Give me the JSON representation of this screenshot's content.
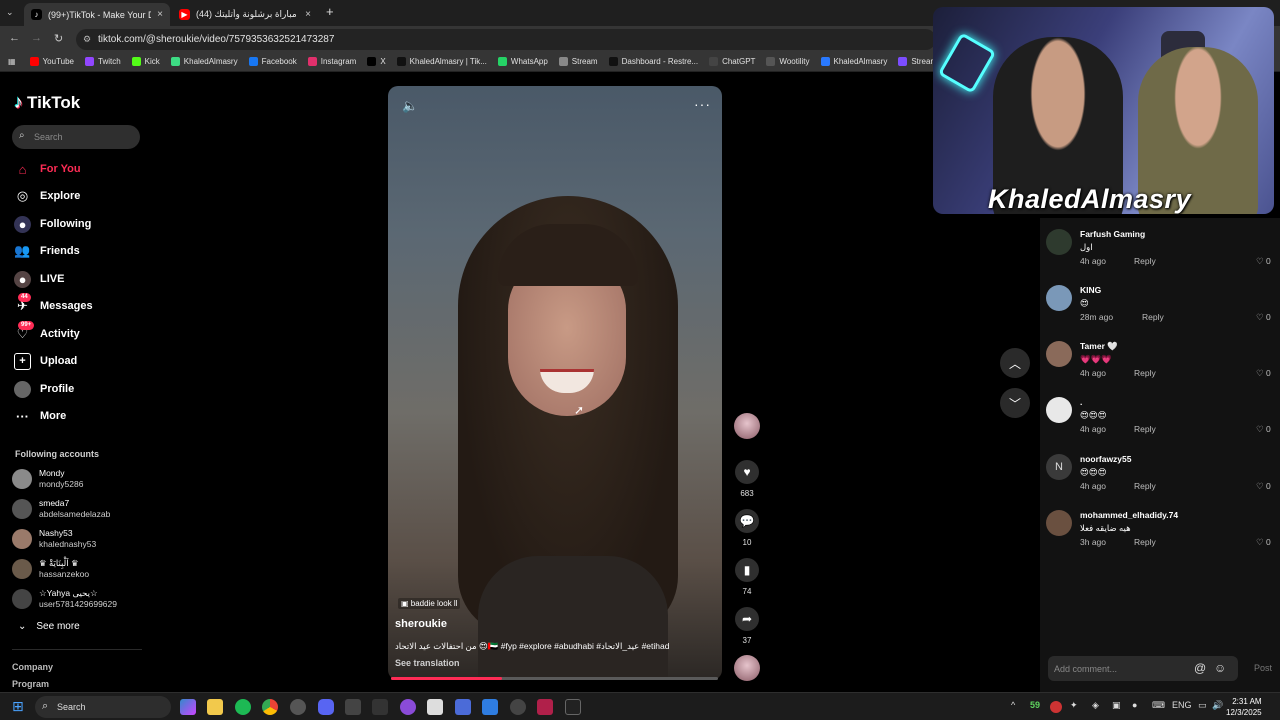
{
  "browser": {
    "tabs": [
      {
        "label": "(99+)TikTok - Make Your Day",
        "close": "×",
        "icon": "tiktok-icon",
        "active": true
      },
      {
        "label": "(44) ملخص مباراة برشلونة وأتليتك",
        "close": "×",
        "icon": "youtube-icon",
        "active": false
      }
    ],
    "new_tab": "+",
    "url": "tiktok.com/@sheroukie/video/7579353632521473287",
    "bookmarks": [
      {
        "label": "YouTube",
        "color": "#ff0000"
      },
      {
        "label": "Twitch",
        "color": "#9146ff"
      },
      {
        "label": "Kick",
        "color": "#53fc18"
      },
      {
        "label": "KhaledAlmasry",
        "color": "#3ddc84"
      },
      {
        "label": "Facebook",
        "color": "#1877f2"
      },
      {
        "label": "Instagram",
        "color": "#e1306c"
      },
      {
        "label": "X",
        "color": "#000000"
      },
      {
        "label": "KhaledAlmasry | Tik...",
        "color": "#111111"
      },
      {
        "label": "WhatsApp",
        "color": "#25d366"
      },
      {
        "label": "Stream",
        "color": "#888888"
      },
      {
        "label": "Dashboard - Restre...",
        "color": "#111111"
      },
      {
        "label": "ChatGPT",
        "color": "#444444"
      },
      {
        "label": "Wootility",
        "color": "#555555"
      },
      {
        "label": "KhaledAlmasry",
        "color": "#2979ff"
      },
      {
        "label": "StreamCharts",
        "color": "#7c4dff"
      }
    ]
  },
  "tiktok": {
    "logo": "TikTok",
    "search_placeholder": "Search",
    "nav": [
      {
        "label": "For You",
        "icon": "home-icon"
      },
      {
        "label": "Explore",
        "icon": "compass-icon"
      },
      {
        "label": "Following",
        "icon": "following-icon"
      },
      {
        "label": "Friends",
        "icon": "friends-icon"
      },
      {
        "label": "LIVE",
        "icon": "live-icon"
      },
      {
        "label": "Messages",
        "icon": "messages-icon",
        "badge": "44"
      },
      {
        "label": "Activity",
        "icon": "activity-icon",
        "badge": "99+"
      },
      {
        "label": "Upload",
        "icon": "upload-icon"
      },
      {
        "label": "Profile",
        "icon": "profile-icon"
      },
      {
        "label": "More",
        "icon": "more-icon"
      }
    ],
    "following_title": "Following accounts",
    "accounts": [
      {
        "name": "Mondy",
        "user": "mondy5286"
      },
      {
        "name": "smeda7",
        "user": "abdelsamedelazab"
      },
      {
        "name": "Nashy53",
        "user": "khalednashy53"
      },
      {
        "name": "♛ اَلْبِنَايَةْ ♛",
        "user": "hassanzekoo"
      },
      {
        "name": "☆Yahya يحيى☆",
        "user": "user5781429699629"
      }
    ],
    "see_more": "See more",
    "footer": [
      "Company",
      "Program"
    ],
    "accent": "#fe2c55"
  },
  "video": {
    "tag": "baddie look ll",
    "username": "sheroukie",
    "description": "من احتفالات عيد الاتحاد 😍🇦🇪 #fyp #explore #abudhabi #عيد_الاتحاد #etihad",
    "see_translation": "See translation",
    "progress": 0.34,
    "likes": "683",
    "comments": "10",
    "saves": "74",
    "shares": "37"
  },
  "comments": [
    {
      "name": "Farfush Gaming",
      "text": "اول",
      "time": "4h ago",
      "reply": "Reply",
      "likes": "0"
    },
    {
      "name": "KING",
      "text": "😍",
      "time": "28m ago",
      "reply": "Reply",
      "likes": "0"
    },
    {
      "name": "Tamer 🤍",
      "text": "💗💗💗",
      "time": "4h ago",
      "reply": "Reply",
      "likes": "0"
    },
    {
      "name": ".",
      "text": "😍😍😍",
      "time": "4h ago",
      "reply": "Reply",
      "likes": "0"
    },
    {
      "name": "noorfawzy55",
      "text": "😍😍😍",
      "time": "4h ago",
      "reply": "Reply",
      "likes": "0",
      "initial": "N"
    },
    {
      "name": "mohammed_elhadidy.74",
      "text": "هيه ضايقه فعلا",
      "time": "3h ago",
      "reply": "Reply",
      "likes": "0"
    }
  ],
  "add_comment": {
    "placeholder": "Add comment...",
    "post": "Post"
  },
  "webcam": {
    "overlay_name": "KhaledAlmasry"
  },
  "taskbar": {
    "search": "Search",
    "tray_temp": "59",
    "lang": "ENG",
    "time": "2:31 AM",
    "date": "12/3/2025"
  }
}
